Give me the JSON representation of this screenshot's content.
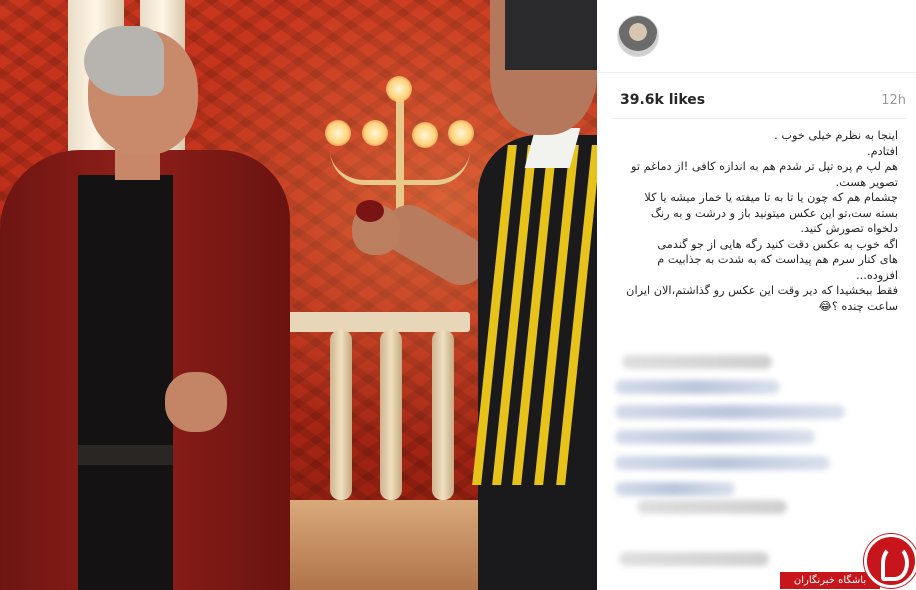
{
  "post": {
    "likes": "39.6k likes",
    "time": "12h"
  },
  "caption": {
    "lines": [
      "اینجا به نظرم خیلی خوب .",
      "افتادم.",
      "هم لپ م پره تپل تر شدم هم به اندازه کافی !از دماغم تو",
      "تصویر هست.",
      "چشمام هم که چون یا تا به تا میفته یا خمار میشه یا کلا",
      "بسته ست،تو این عکس میتونید باز و درشت و به رنگ",
      "دلخواه تصورش کنید.",
      "اگه خوب به عکس دقت کنید رگه هایی از جو گندمی",
      "های کنار سرم هم پیداست که به شدت به جذابیت م",
      "افزوده...",
      "فقط ببخشیدا که دیر وقت این عکس رو گذاشتم،الان ایران",
      "ساعت چنده ؟😂"
    ]
  },
  "watermark": {
    "text": "باشگاه خبرنگاران"
  },
  "colors": {
    "accent": "#c8151b",
    "text": "#262626",
    "muted": "#999999"
  }
}
